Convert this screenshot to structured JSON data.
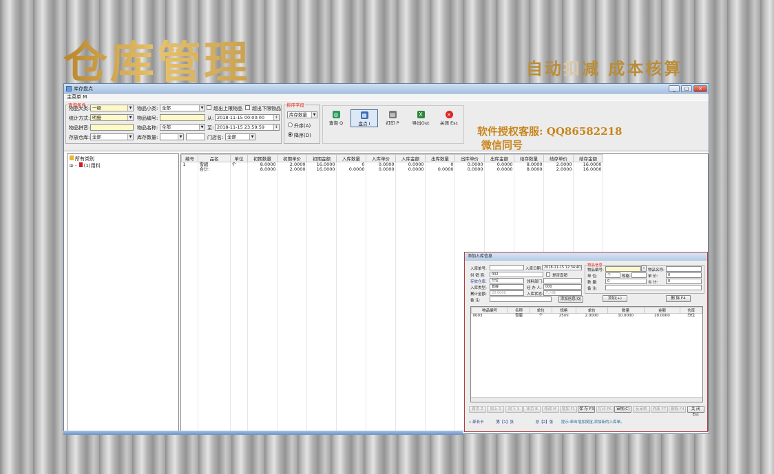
{
  "banner": {
    "title": "仓库管理",
    "slogan_a": "自动",
    "slogan_fade": "扣",
    "slogan_b": "减",
    "slogan_c": " 成本核算"
  },
  "window": {
    "title": "库存盘点",
    "menu": "主菜单 M",
    "ctrl_min": "_",
    "ctrl_max": "□",
    "ctrl_close": "×"
  },
  "query": {
    "legend": "查询条件",
    "big_class_label": "物品大类:",
    "big_class_value": "一级",
    "small_class_label": "物品小类:",
    "small_class_value": "全部",
    "over_upper_label": "超出上限物品",
    "over_lower_label": "超出下限物品",
    "stat_mode_label": "统计方式:",
    "stat_mode_value": "明细",
    "item_code_label": "物品编号:",
    "item_code_value": "",
    "from_label": "从:",
    "from_value": "2018-11-15 00:00:00",
    "pinyin_label": "物品拼音:",
    "pinyin_value": "",
    "item_name_label": "物品名称:",
    "item_name_value": "全部",
    "to_label": "至:",
    "to_value": "2018-11-15 23:59:59",
    "warehouse_label": "存放仓库:",
    "warehouse_value": "全部",
    "stock_qty_label": "库存数量:",
    "stock_qty_value": "",
    "store_label": "门店名:",
    "store_value": "全部"
  },
  "sort": {
    "legend": "排序字段",
    "field_value": "库存数量",
    "asc_label": "升序(A)",
    "desc_label": "降序(D)"
  },
  "toolbar": {
    "query": "查询 Q",
    "count": "盘点 I",
    "print": "打印 P",
    "export": "导出Out",
    "close": "关闭 Esc"
  },
  "ad": {
    "line1": "软件授权客服: QQ86582218",
    "line2": "微信同号"
  },
  "tree": {
    "root": "所有类别",
    "child": "(1)用料"
  },
  "table": {
    "headers": [
      "编号",
      "品名",
      "单位",
      "初期数量",
      "初期单价",
      "初期金额",
      "入库数量",
      "入库单价",
      "入库金额",
      "出库数量",
      "出库单价",
      "出库金额",
      "结存数量",
      "结存单价",
      "结存金额"
    ],
    "rows": [
      [
        "1",
        "雪碧",
        "个",
        "8.0000",
        "2.0000",
        "16.0000",
        "0",
        "0.0000",
        "0.0000",
        "0",
        "0.0000",
        "0.0000",
        "8.0000",
        "2.0000",
        "16.0000"
      ],
      [
        "",
        "合计:",
        "",
        "8.0000",
        "2.0000",
        "16.0000",
        "0.0000",
        "0.0000",
        "0.0000",
        "0.0000",
        "0.0000",
        "0.0000",
        "8.0000",
        "2.0000",
        "16.0000"
      ]
    ]
  },
  "dialog": {
    "title": "添加入库信息",
    "in_no_label": "入库单号:",
    "in_no_value": "",
    "in_date_label": "入库日期:",
    "in_date_value": "2018-11-15 12:34:40",
    "supplier_label": "供 销 商:",
    "supplier_value": "002",
    "settled_label": "是否直销",
    "warehouse_label": "存放仓库:",
    "warehouse_value": "分位",
    "dept_label": "领料部门:",
    "dept_value": "",
    "in_type_label": "入库类型:",
    "in_type_value": "直接",
    "handler_label": "经 办 人:",
    "handler_value": "000",
    "total_label": "累计金额:",
    "total_value": "20.0000",
    "status_label": "入库状态:",
    "status_value": "已入库",
    "remark_label": "备  注:",
    "remark_value": "",
    "add_info_btn": "添加信息(Q)",
    "item_legend": "物品信息",
    "item_code_label": "物品编号:",
    "item_code_value": "",
    "item_name_label": "物品名称:",
    "item_name_value": "",
    "unit_label": "单  位:",
    "unit_value": "个",
    "spec_label": "规格:",
    "spec_value": "",
    "price_label": "单  价:",
    "price_value": "0",
    "qty_label": "数  量:",
    "qty_value": "0",
    "amount_label": "合  计:",
    "amount_value": "0",
    "note_label": "备  注:",
    "note_value": "",
    "add_btn": "添加(+)",
    "del_btn": "删 除 F4",
    "grid_headers": [
      "物品编号",
      "名称",
      "单位",
      "规格",
      "单价",
      "数量",
      "金额",
      "仓库"
    ],
    "grid_rows": [
      [
        "0003",
        "雪碧",
        "个",
        "25ml",
        "2.0000",
        "10.0000",
        "20.0000",
        "分位"
      ]
    ],
    "buttons": [
      "首页 Z",
      "向上 S",
      "向下 X",
      "末页 B",
      "修改 M",
      "增加 F1",
      "保 存 F3",
      "打印 F6",
      "审核(C)",
      "反审核",
      "作废 F7",
      "删除 F4",
      "关 闭 Esc"
    ],
    "status_a": "» 部长卡",
    "status_b": "第【1】张",
    "status_c": "总【2】张",
    "status_d": "提示:单击增加按钮,添加新的入库单。"
  }
}
